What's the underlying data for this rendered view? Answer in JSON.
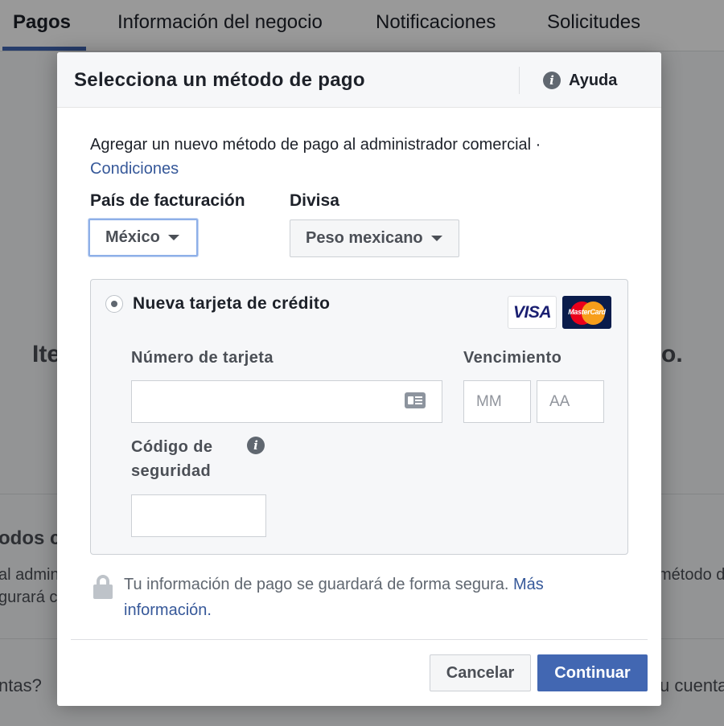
{
  "tabs": [
    {
      "label": "Pagos",
      "active": true
    },
    {
      "label": "Información del negocio",
      "active": false
    },
    {
      "label": "Notificaciones",
      "active": false
    },
    {
      "label": "Solicitudes",
      "active": false
    }
  ],
  "background": {
    "heading_left": "Ite",
    "heading_right": "o.",
    "section_left": "odos c",
    "line1_left": "al admin",
    "line1_right": "método d",
    "line2_left": "gurará c",
    "bottom_left": "ntas?",
    "bottom_right": "u cuenta"
  },
  "modal": {
    "title": "Selecciona un método de pago",
    "help_label": "Ayuda",
    "intro_text": "Agregar un nuevo método de pago al administrador comercial ·",
    "conditions_link": "Condiciones",
    "country_label": "País de facturación",
    "country_value": "México",
    "currency_label": "Divisa",
    "currency_value": "Peso mexicano",
    "card": {
      "option_label": "Nueva tarjeta de crédito",
      "visa_label": "VISA",
      "mastercard_label": "MasterCard",
      "number_label": "Número de tarjeta",
      "number_value": "",
      "expiry_label": "Vencimiento",
      "month_placeholder": "MM",
      "year_placeholder": "AA",
      "security_label_line1": "Código de",
      "security_label_line2": "seguridad",
      "security_value": ""
    },
    "secure_text": "Tu información de pago se guardará de forma segura.",
    "more_info_link": "Más información.",
    "cancel_label": "Cancelar",
    "continue_label": "Continuar"
  },
  "colors": {
    "primary": "#4267b2",
    "link": "#365899",
    "overlay": "rgba(0,0,0,0.4)"
  }
}
